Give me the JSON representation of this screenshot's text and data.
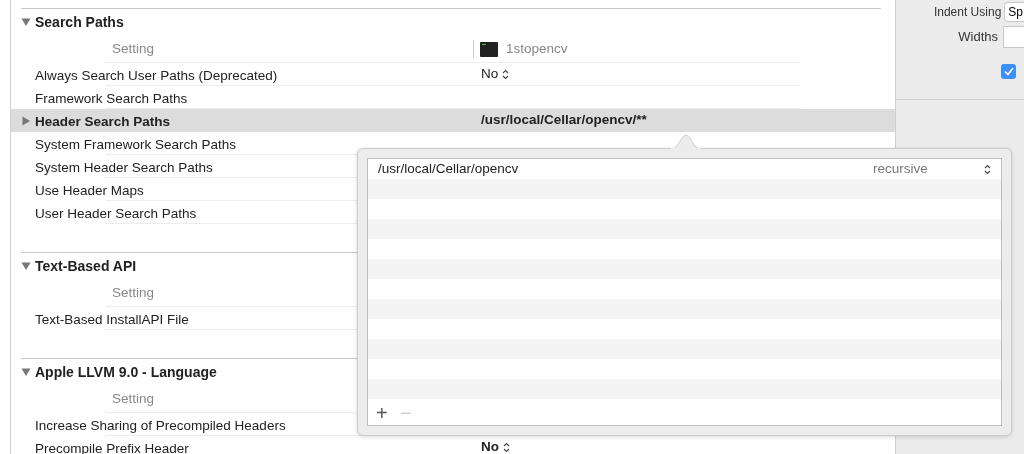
{
  "sections": [
    {
      "title": "Search Paths",
      "expanded": true,
      "column_header": "Setting",
      "target": "1stopencv",
      "rows": [
        {
          "label": "Always Search User Paths (Deprecated)",
          "value": "No",
          "kind": "popup",
          "selected": false,
          "modified": false
        },
        {
          "label": "Framework Search Paths",
          "selected": false
        },
        {
          "label": "Header Search Paths",
          "value": "/usr/local/Cellar/opencv/**",
          "kind": "text",
          "selected": true,
          "modified": true,
          "expanded": false
        },
        {
          "label": "System Framework Search Paths",
          "selected": false
        },
        {
          "label": "System Header Search Paths",
          "selected": false
        },
        {
          "label": "Use Header Maps",
          "selected": false
        },
        {
          "label": "User Header Search Paths",
          "selected": false
        }
      ]
    },
    {
      "title": "Text-Based API",
      "expanded": true,
      "column_header": "Setting",
      "rows": [
        {
          "label": "Text-Based InstallAPI File",
          "selected": false
        }
      ]
    },
    {
      "title": "Apple LLVM 9.0 - Language",
      "expanded": true,
      "column_header": "Setting",
      "rows": [
        {
          "label": "Increase Sharing of Precompiled Headers",
          "selected": false
        },
        {
          "label": "Precompile Prefix Header",
          "value": "No",
          "kind": "popup",
          "selected": false,
          "modified": true
        }
      ]
    }
  ],
  "popover": {
    "items": [
      {
        "path": "/usr/local/Cellar/opencv",
        "mode": "recursive"
      }
    ],
    "add_button": {
      "label": "+",
      "disabled": false
    },
    "remove_button": {
      "label": "−",
      "disabled": true
    }
  },
  "inspector": {
    "indent_label": "Indent Using",
    "indent_value": "Sp",
    "widths_label": "Widths",
    "checkbox": {
      "checked": true
    }
  }
}
